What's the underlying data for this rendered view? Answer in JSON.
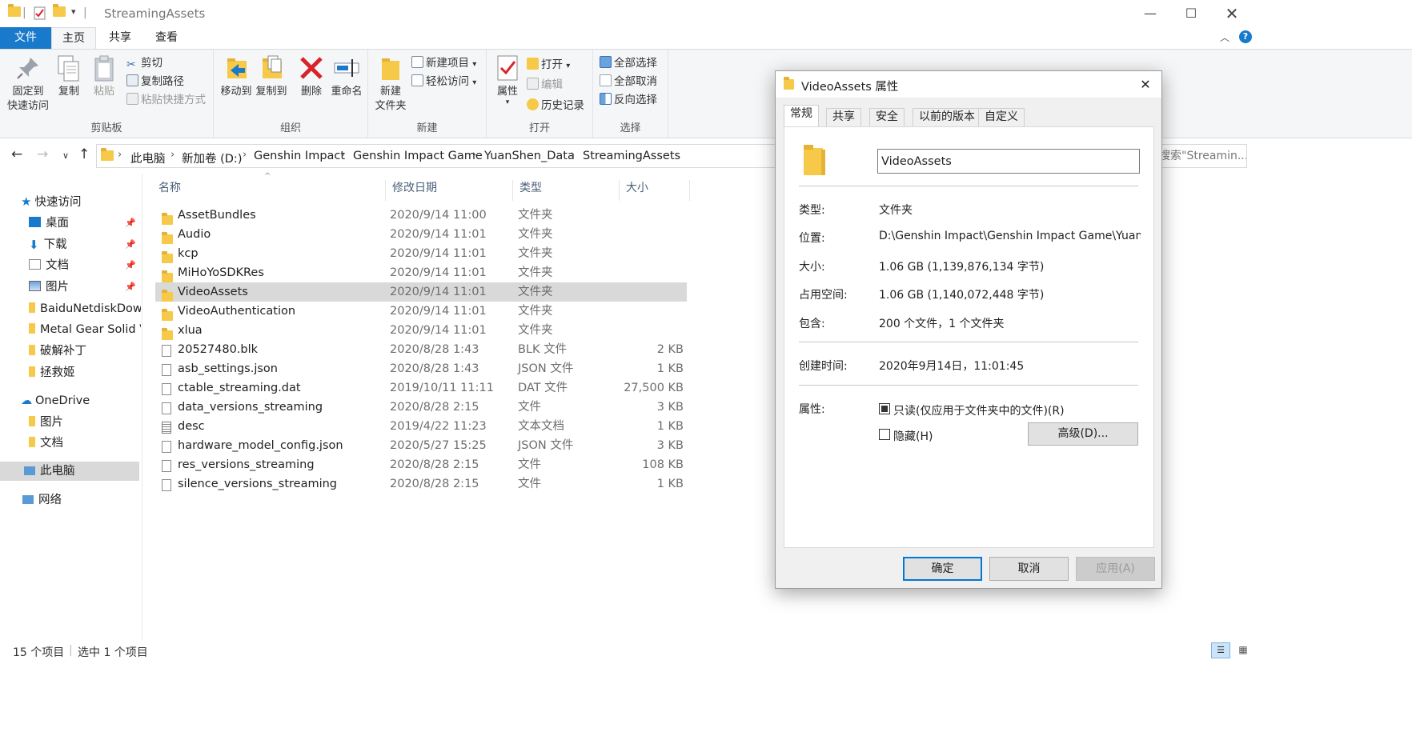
{
  "window": {
    "title": "StreamingAssets",
    "quick_access_toolbar": [
      "folder-icon",
      "properties-check-icon",
      "new-folder-icon",
      "customize-dropdown-icon"
    ]
  },
  "ribbon_tabs": [
    {
      "label": "文件",
      "active": false
    },
    {
      "label": "主页",
      "active": true
    },
    {
      "label": "共享",
      "active": false
    },
    {
      "label": "查看",
      "active": false
    }
  ],
  "ribbon": {
    "clipboard": {
      "label": "剪贴板",
      "pin": "固定到\n快速访问",
      "pin_line1": "固定到",
      "pin_line2": "快速访问",
      "copy": "复制",
      "paste": "粘贴",
      "cut": "剪切",
      "copy_path": "复制路径",
      "paste_shortcut": "粘贴快捷方式"
    },
    "organize": {
      "label": "组织",
      "move_to": "移动到",
      "copy_to": "复制到",
      "delete": "删除",
      "rename": "重命名"
    },
    "new": {
      "label": "新建",
      "new_folder_line1": "新建",
      "new_folder_line2": "文件夹",
      "new_item": "新建项目",
      "easy_access": "轻松访问"
    },
    "open": {
      "label": "打开",
      "properties": "属性",
      "open": "打开",
      "edit": "编辑",
      "history": "历史记录"
    },
    "select": {
      "label": "选择",
      "select_all": "全部选择",
      "select_none": "全部取消",
      "invert": "反向选择"
    }
  },
  "address": {
    "breadcrumbs": [
      "此电脑",
      "新加卷 (D:)",
      "Genshin Impact",
      "Genshin Impact Game",
      "YuanShen_Data",
      "StreamingAssets"
    ],
    "search_placeholder": "搜索\"Streamin..."
  },
  "nav_pane": {
    "quick_access": "快速访问",
    "items": [
      {
        "label": "桌面",
        "pinned": true,
        "icon": "desktop-icon"
      },
      {
        "label": "下载",
        "pinned": true,
        "icon": "download-icon"
      },
      {
        "label": "文档",
        "pinned": true,
        "icon": "documents-icon"
      },
      {
        "label": "图片",
        "pinned": true,
        "icon": "pictures-icon"
      },
      {
        "label": "BaiduNetdiskDow",
        "pinned": false,
        "icon": "folder-icon"
      },
      {
        "label": "Metal Gear Solid V",
        "pinned": false,
        "icon": "folder-icon"
      },
      {
        "label": "破解补丁",
        "pinned": false,
        "icon": "folder-icon"
      },
      {
        "label": "拯救姬",
        "pinned": false,
        "icon": "folder-icon"
      }
    ],
    "onedrive": "OneDrive",
    "onedrive_items": [
      {
        "label": "图片",
        "icon": "folder-icon"
      },
      {
        "label": "文档",
        "icon": "folder-icon"
      }
    ],
    "this_pc": "此电脑",
    "network": "网络"
  },
  "file_list": {
    "columns": {
      "name": "名称",
      "date": "修改日期",
      "type": "类型",
      "size": "大小"
    },
    "rows": [
      {
        "name": "AssetBundles",
        "date": "2020/9/14 11:00",
        "type": "文件夹",
        "size": "",
        "kind": "folder"
      },
      {
        "name": "Audio",
        "date": "2020/9/14 11:01",
        "type": "文件夹",
        "size": "",
        "kind": "folder"
      },
      {
        "name": "kcp",
        "date": "2020/9/14 11:01",
        "type": "文件夹",
        "size": "",
        "kind": "folder"
      },
      {
        "name": "MiHoYoSDKRes",
        "date": "2020/9/14 11:01",
        "type": "文件夹",
        "size": "",
        "kind": "folder"
      },
      {
        "name": "VideoAssets",
        "date": "2020/9/14 11:01",
        "type": "文件夹",
        "size": "",
        "kind": "folder",
        "selected": true
      },
      {
        "name": "VideoAuthentication",
        "date": "2020/9/14 11:01",
        "type": "文件夹",
        "size": "",
        "kind": "folder"
      },
      {
        "name": "xlua",
        "date": "2020/9/14 11:01",
        "type": "文件夹",
        "size": "",
        "kind": "folder"
      },
      {
        "name": "20527480.blk",
        "date": "2020/8/28 1:43",
        "type": "BLK 文件",
        "size": "2 KB",
        "kind": "file"
      },
      {
        "name": "asb_settings.json",
        "date": "2020/8/28 1:43",
        "type": "JSON 文件",
        "size": "1 KB",
        "kind": "file"
      },
      {
        "name": "ctable_streaming.dat",
        "date": "2019/10/11 11:11",
        "type": "DAT 文件",
        "size": "27,500 KB",
        "kind": "file"
      },
      {
        "name": "data_versions_streaming",
        "date": "2020/8/28 2:15",
        "type": "文件",
        "size": "3 KB",
        "kind": "file"
      },
      {
        "name": "desc",
        "date": "2019/4/22 11:23",
        "type": "文本文档",
        "size": "1 KB",
        "kind": "text"
      },
      {
        "name": "hardware_model_config.json",
        "date": "2020/5/27 15:25",
        "type": "JSON 文件",
        "size": "3 KB",
        "kind": "file"
      },
      {
        "name": "res_versions_streaming",
        "date": "2020/8/28 2:15",
        "type": "文件",
        "size": "108 KB",
        "kind": "file"
      },
      {
        "name": "silence_versions_streaming",
        "date": "2020/8/28 2:15",
        "type": "文件",
        "size": "1 KB",
        "kind": "file"
      }
    ]
  },
  "status": {
    "count": "15 个项目",
    "selected": "选中 1 个项目"
  },
  "dialog": {
    "title": "VideoAssets 属性",
    "tabs": [
      "常规",
      "共享",
      "安全",
      "以前的版本",
      "自定义"
    ],
    "name_value": "VideoAssets",
    "type_label": "类型:",
    "type_value": "文件夹",
    "location_label": "位置:",
    "location_value": "D:\\Genshin Impact\\Genshin Impact Game\\YuanShen_Data",
    "size_label": "大小:",
    "size_value": "1.06 GB (1,139,876,134 字节)",
    "size_on_disk_label": "占用空间:",
    "size_on_disk_value": "1.06 GB (1,140,072,448 字节)",
    "contains_label": "包含:",
    "contains_value": "200 个文件，1 个文件夹",
    "created_label": "创建时间:",
    "created_value": "2020年9月14日，11:01:45",
    "attributes_label": "属性:",
    "readonly_label": "只读(仅应用于文件夹中的文件)(R)",
    "hidden_label": "隐藏(H)",
    "advanced_button": "高级(D)...",
    "ok_button": "确定",
    "cancel_button": "取消",
    "apply_button": "应用(A)"
  },
  "colors": {
    "file_tab_bg": "#1979ca",
    "folder_yellow": "#f7c948",
    "selection_bg": "#d9d9d9",
    "delete_red": "#d8232a",
    "accent_blue": "#0078d7"
  }
}
